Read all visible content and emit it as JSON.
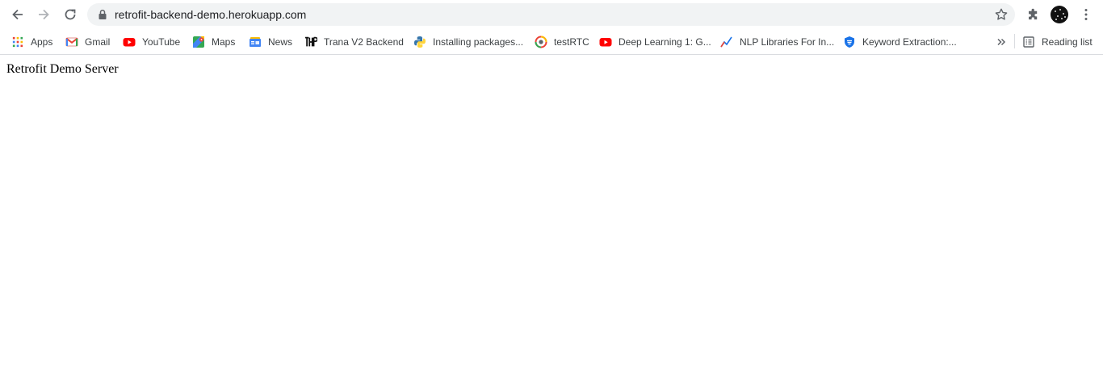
{
  "browser": {
    "url": "retrofit-backend-demo.herokuapp.com"
  },
  "bookmarks": [
    {
      "label": "Apps",
      "icon": "apps-grid-icon"
    },
    {
      "label": "Gmail",
      "icon": "gmail-icon"
    },
    {
      "label": "YouTube",
      "icon": "youtube-icon"
    },
    {
      "label": "Maps",
      "icon": "maps-icon"
    },
    {
      "label": "News",
      "icon": "news-icon"
    },
    {
      "label": "Trana V2 Backend",
      "icon": "trana-logo-icon"
    },
    {
      "label": "Installing packages...",
      "icon": "python-icon"
    },
    {
      "label": "testRTC",
      "icon": "testrtc-icon"
    },
    {
      "label": "Deep Learning 1: G...",
      "icon": "youtube-icon"
    },
    {
      "label": "NLP Libraries For In...",
      "icon": "trend-icon"
    },
    {
      "label": "Keyword Extraction:...",
      "icon": "shield-icon"
    }
  ],
  "reading_list": {
    "label": "Reading list"
  },
  "page": {
    "text": "Retrofit Demo Server"
  },
  "colors": {
    "omnibox_bg": "#f1f3f4",
    "youtube_red": "#ff0000",
    "gmail_red": "#ea4335",
    "google_blue": "#4285f4",
    "google_green": "#34a853",
    "google_yellow": "#fbbc04"
  }
}
